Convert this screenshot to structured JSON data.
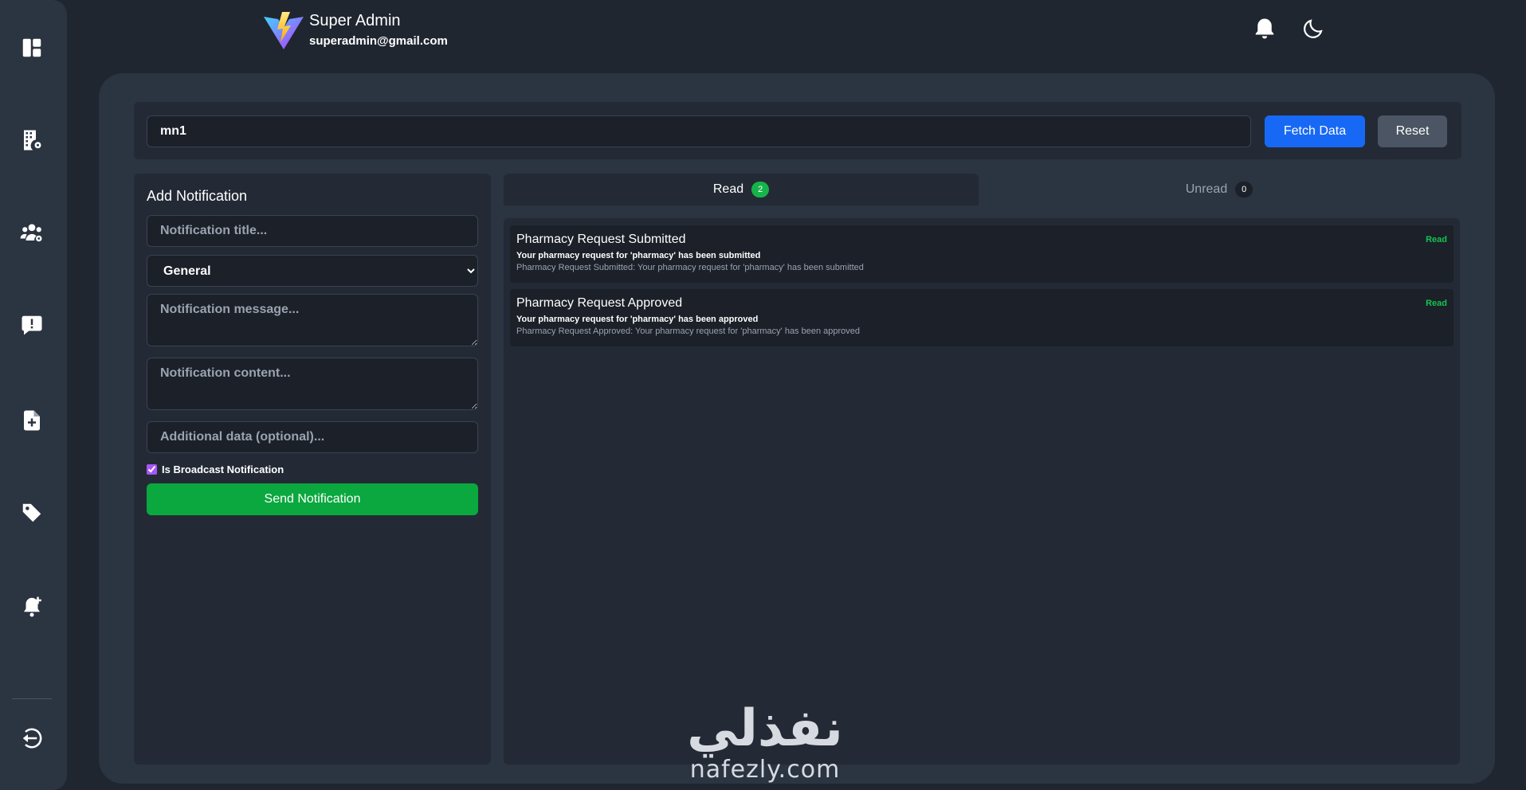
{
  "header": {
    "user_name": "Super Admin",
    "user_email": "superadmin@gmail.com",
    "icons": [
      "bell-icon",
      "moon-icon"
    ]
  },
  "sidebar": {
    "items": [
      {
        "name": "dashboard-icon"
      },
      {
        "name": "building-settings-icon"
      },
      {
        "name": "users-settings-icon"
      },
      {
        "name": "message-alert-icon"
      },
      {
        "name": "file-add-icon"
      },
      {
        "name": "tag-icon"
      },
      {
        "name": "bell-add-icon"
      },
      {
        "name": "logout-icon"
      }
    ]
  },
  "search": {
    "value": "mn1",
    "fetch_label": "Fetch Data",
    "reset_label": "Reset"
  },
  "form": {
    "title": "Add Notification",
    "title_placeholder": "Notification title...",
    "type_selected": "General",
    "message_placeholder": "Notification message...",
    "content_placeholder": "Notification content...",
    "additional_placeholder": "Additional data (optional)...",
    "broadcast_label": "Is Broadcast Notification",
    "broadcast_checked": true,
    "send_label": "Send Notification"
  },
  "tabs": {
    "read_label": "Read",
    "read_count": "2",
    "unread_label": "Unread",
    "unread_count": "0"
  },
  "notifications": [
    {
      "title": "Pharmacy Request Submitted",
      "message": "Your pharmacy request for 'pharmacy' has been submitted",
      "content": "Pharmacy Request Submitted: Your pharmacy request for 'pharmacy' has been submitted",
      "status": "Read"
    },
    {
      "title": "Pharmacy Request Approved",
      "message": "Your pharmacy request for 'pharmacy' has been approved",
      "content": "Pharmacy Request Approved: Your pharmacy request for 'pharmacy' has been approved",
      "status": "Read"
    }
  ],
  "watermark": {
    "arabic": "نفذلي",
    "latin": "nafezly.com"
  },
  "colors": {
    "accent_blue": "#1769f5",
    "success_green": "#0aa83f",
    "status_green": "#16c24d"
  }
}
